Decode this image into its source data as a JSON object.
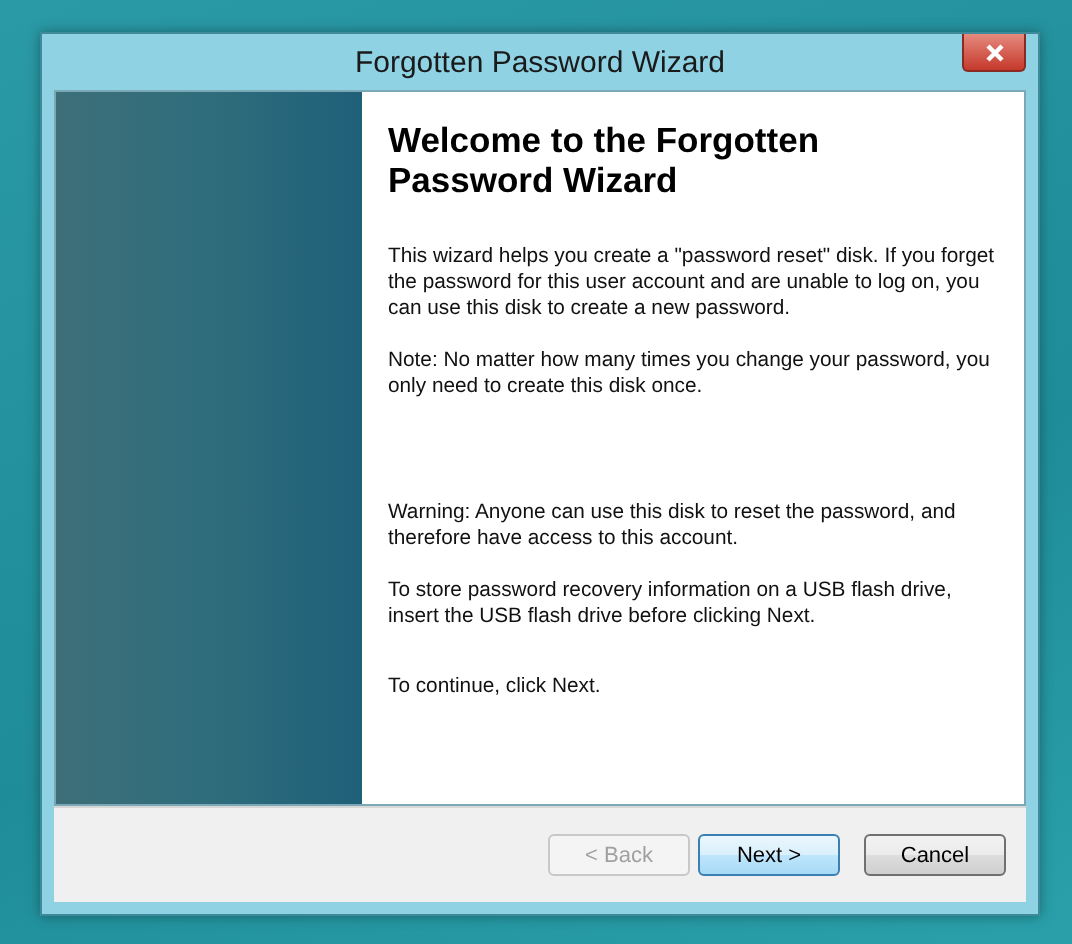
{
  "window": {
    "title": "Forgotten Password Wizard"
  },
  "heading": "Welcome to the Forgotten Password Wizard",
  "paragraphs": [
    {
      "text": "This wizard helps you create a \"password reset\" disk. If you forget the password for this user account and are unable to log on, you can use this disk to create a new password."
    },
    {
      "text": "Note: No matter how many times you change your password, you only need to create this disk once."
    },
    {
      "text": "Warning: Anyone can use this disk to reset the password, and therefore have access to this account."
    },
    {
      "text": "To store password recovery information on a USB flash drive, insert the USB flash drive before clicking Next."
    },
    {
      "text": "To continue, click Next."
    }
  ],
  "buttons": [
    {
      "label": "< Back",
      "disabled": true,
      "default": false
    },
    {
      "label": "Next >",
      "disabled": false,
      "default": true
    },
    {
      "label": "Cancel",
      "disabled": false,
      "default": false
    }
  ]
}
